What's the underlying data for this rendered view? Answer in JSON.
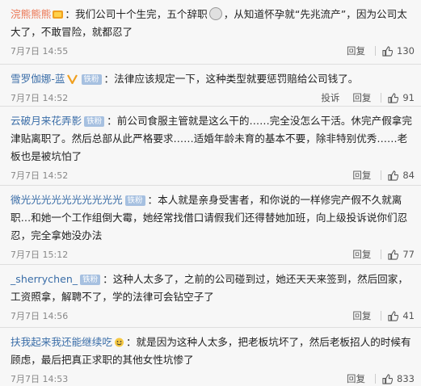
{
  "comments": [
    {
      "user": "浣熊熊熊",
      "text": "我们公司十个生完，五个辞职",
      "text2": "，从知道怀孕就“先兆流产”，因为公司太大了，不敢冒险，就都忍了",
      "time": "7月7日 14:55",
      "reply": "回复",
      "likes": "130"
    },
    {
      "user": "雪罗伽娜-蓝",
      "fan": "铁粉",
      "text": "法律应该规定一下，这种类型就要惩罚赔给公司钱了。",
      "time": "7月7日 14:52",
      "report": "投诉",
      "reply": "回复",
      "likes": "91"
    },
    {
      "user": "云破月来花弄影",
      "fan": "铁粉",
      "text": "前公司食服主管就是这么干的……完全没怎么干活。休完产假拿完津贴离职了。然后总部从此严格要求……适婚年龄未育的基本不要，除非特别优秀……老板也是被坑怕了",
      "time": "7月7日 14:52",
      "reply": "回复",
      "likes": "84"
    },
    {
      "user": "微光光光光光光光光光光",
      "fan": "铁粉",
      "text": "本人就是亲身受害者，和你说的一样修完产假不久就离职…和她一个工作组倒大霉，她经常找借口请假我们还得替她加班，向上级投诉说你们忍忍，完全拿她没办法",
      "time": "7月7日 15:12",
      "reply": "回复",
      "likes": "77"
    },
    {
      "user": "_sherrychen_",
      "fan": "铁粉",
      "text": "这种人太多了，之前的公司碰到过，她还天天来签到，然后回家，工资照拿，解聘不了，学的法律可会钻空子了",
      "time": "7月7日 14:56",
      "reply": "回复",
      "likes": "41"
    },
    {
      "user": "扶我起来我还能继续吃",
      "text": "就是因为这种人太多，把老板坑坏了，然后老板招人的时候有顾虑，最后把真正求职的其他女性坑惨了",
      "time": "7月7日 14:53",
      "reply": "回复",
      "likes": "833"
    }
  ]
}
